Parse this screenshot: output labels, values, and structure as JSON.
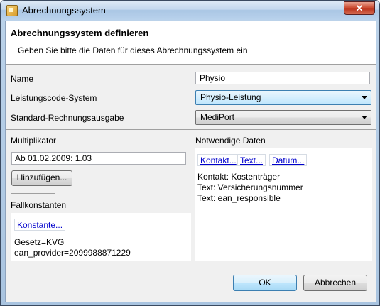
{
  "window": {
    "title": "Abrechnungssystem",
    "close_glyph": "✕"
  },
  "header": {
    "title": "Abrechnungssystem definieren",
    "description": "Geben Sie bitte die Daten für dieses Abrechnungssystem ein"
  },
  "form": {
    "name_label": "Name",
    "name_value": "Physio",
    "code_system_label": "Leistungscode-System",
    "code_system_value": "Physio-Leistung",
    "output_label": "Standard-Rechnungsausgabe",
    "output_value": "MediPort"
  },
  "multiplier": {
    "label": "Multiplikator",
    "value": "Ab 01.02.2009: 1.03",
    "add_button": "Hinzufügen..."
  },
  "case_constants": {
    "label": "Fallkonstanten",
    "link": "Konstante...",
    "lines": [
      "Gesetz=KVG",
      "ean_provider=2099988871229"
    ]
  },
  "required_data": {
    "label": "Notwendige Daten",
    "links": [
      "Kontakt...",
      "Text...",
      "Datum..."
    ],
    "lines": [
      "Kontakt: Kostenträger",
      "Text: Versicherungsnummer",
      "Text: ean_responsible"
    ]
  },
  "buttons": {
    "ok": "OK",
    "cancel": "Abbrechen"
  }
}
